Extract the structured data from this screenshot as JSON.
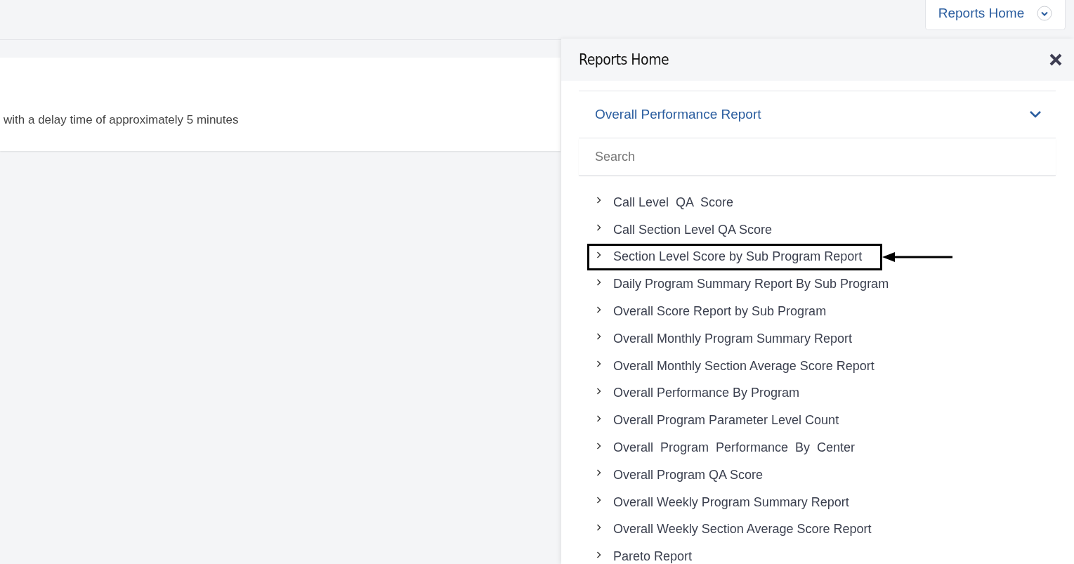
{
  "top_bar": {
    "menu_button": {
      "label": "Reports Home"
    }
  },
  "notice": {
    "text": "with a delay time of approximately 5 minutes"
  },
  "panel": {
    "title": "Reports Home",
    "dropdown": {
      "value": "Overall Performance Report"
    },
    "search": {
      "placeholder": "Search"
    },
    "reports": [
      {
        "label": "Call Level  QA  Score",
        "marked": false
      },
      {
        "label": "Call Section Level QA Score",
        "marked": false
      },
      {
        "label": "Section Level Score by Sub Program Report",
        "marked": true
      },
      {
        "label": "Daily Program Summary Report By Sub Program",
        "marked": false
      },
      {
        "label": "Overall Score Report by Sub Program",
        "marked": false
      },
      {
        "label": "Overall Monthly Program Summary Report",
        "marked": false
      },
      {
        "label": "Overall Monthly Section Average Score Report",
        "marked": false
      },
      {
        "label": "Overall Performance By Program",
        "marked": false
      },
      {
        "label": "Overall Program Parameter Level Count",
        "marked": false
      },
      {
        "label": "Overall  Program  Performance  By  Center",
        "marked": false
      },
      {
        "label": "Overall Program QA Score",
        "marked": false
      },
      {
        "label": "Overall Weekly Program Summary Report",
        "marked": false
      },
      {
        "label": "Overall Weekly Section Average Score Report",
        "marked": false
      },
      {
        "label": "Pareto Report",
        "marked": false
      }
    ]
  }
}
